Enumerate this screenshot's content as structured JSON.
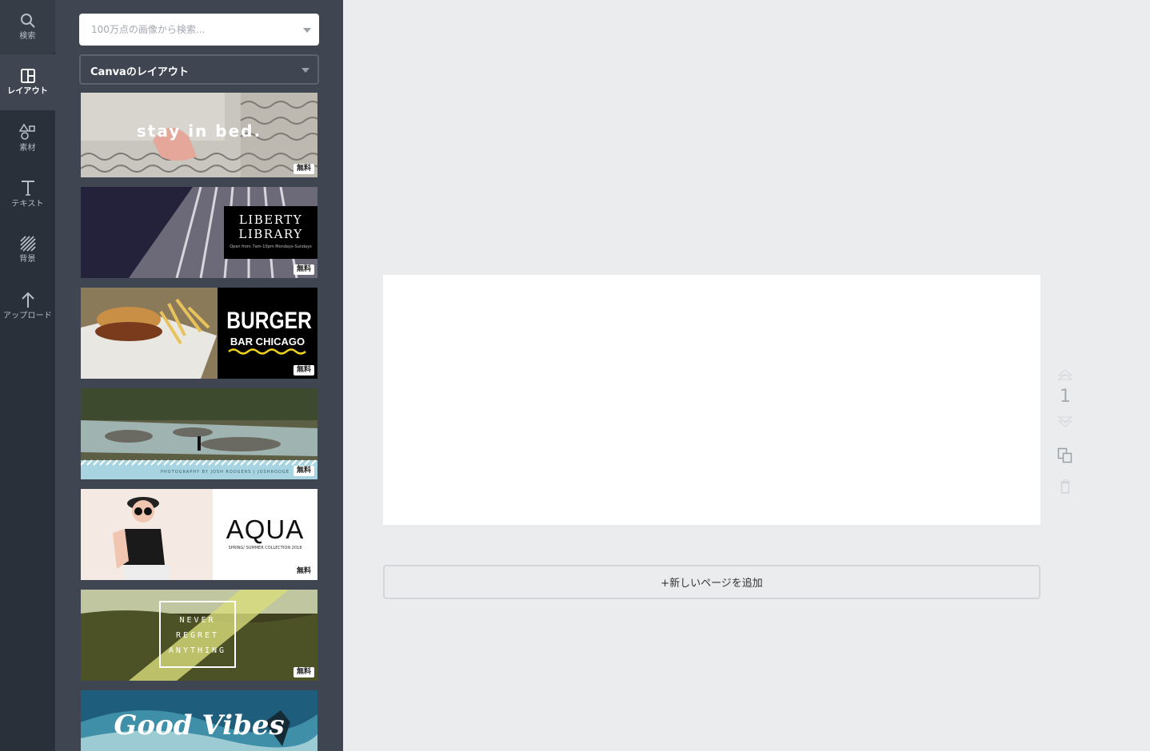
{
  "rail": {
    "items": [
      {
        "label": "検索",
        "icon": "search-icon"
      },
      {
        "label": "レイアウト",
        "icon": "layout-icon"
      },
      {
        "label": "素材",
        "icon": "shapes-icon"
      },
      {
        "label": "テキスト",
        "icon": "text-icon"
      },
      {
        "label": "背景",
        "icon": "background-icon"
      },
      {
        "label": "アップロード",
        "icon": "upload-icon"
      }
    ],
    "active": "レイアウト"
  },
  "panel": {
    "search_placeholder": "100万点の画像から検索...",
    "layout_select": "Canvaのレイアウト",
    "badge": "無料",
    "templates": [
      {
        "text": "stay in bed."
      },
      {
        "title": "LIBERTY LIBRARY",
        "subtitle": "Open from 7am-10pm Mondays-Sundays"
      },
      {
        "title": "BURGER",
        "subtitle": "BAR CHICAGO"
      },
      {
        "caption": "PHOTOGRAPHY BY JOSH RODGERS | JOSHRODGE"
      },
      {
        "title": "AQUA",
        "subtitle": "SPRING/ SUMMER COLLECTION 2018"
      },
      {
        "lines": [
          "NEVER",
          "REGRET",
          "ANYTHING"
        ]
      },
      {
        "title": "Good Vibes"
      }
    ]
  },
  "main": {
    "page_number": "1",
    "add_page_label": "+新しいページを追加"
  },
  "colors": {
    "rail_bg": "#293039",
    "panel_bg": "#3f4652",
    "workspace_bg": "#ebecee"
  }
}
